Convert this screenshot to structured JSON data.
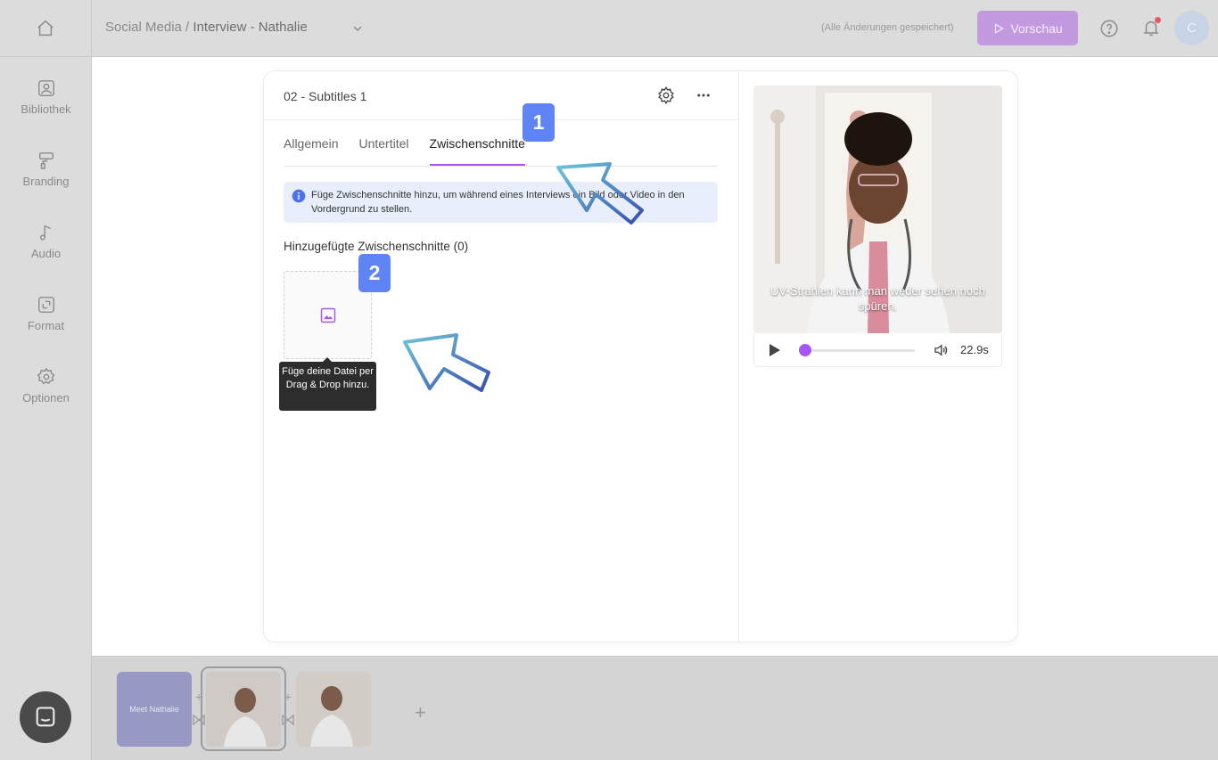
{
  "topbar": {
    "breadcrumb_parent": "Social Media",
    "breadcrumb_separator": " / ",
    "breadcrumb_current": "Interview - Nathalie",
    "saved_status": "(Alle Änderungen gespeichert)",
    "preview_label": "Vorschau",
    "avatar_initial": "C"
  },
  "sidebar": {
    "items": [
      {
        "label": "Bibliothek",
        "icon": "image-icon"
      },
      {
        "label": "Branding",
        "icon": "paint-roller-icon"
      },
      {
        "label": "Audio",
        "icon": "music-note-icon"
      },
      {
        "label": "Format",
        "icon": "resize-icon"
      },
      {
        "label": "Optionen",
        "icon": "gear-icon"
      }
    ]
  },
  "editor": {
    "title": "02 - Subtitles 1",
    "tabs": [
      {
        "label": "Allgemein"
      },
      {
        "label": "Untertitel"
      },
      {
        "label": "Zwischenschnitte",
        "active": true
      }
    ],
    "info_text": "Füge Zwischenschnitte hinzu, um während eines Interviews ein Bild oder Video in den Vordergrund zu stellen.",
    "added_title": "Hinzugefügte Zwischenschnitte (0)",
    "dropzone_tooltip": "Füge deine Datei per Drag & Drop hinzu.",
    "badge_1": "1",
    "badge_2": "2"
  },
  "video": {
    "subtitle": "UV-Strahlen kann man weder sehen noch spüren.",
    "time": "22.9s",
    "progress": 0.04
  },
  "filmstrip": {
    "scene_1_label": "Meet Nathalie",
    "add_symbol": "+"
  },
  "colors": {
    "accent": "#a855f7",
    "preview_button": "#c39ae0",
    "badge": "#5f84f5",
    "info_bg": "#e8eefb"
  }
}
